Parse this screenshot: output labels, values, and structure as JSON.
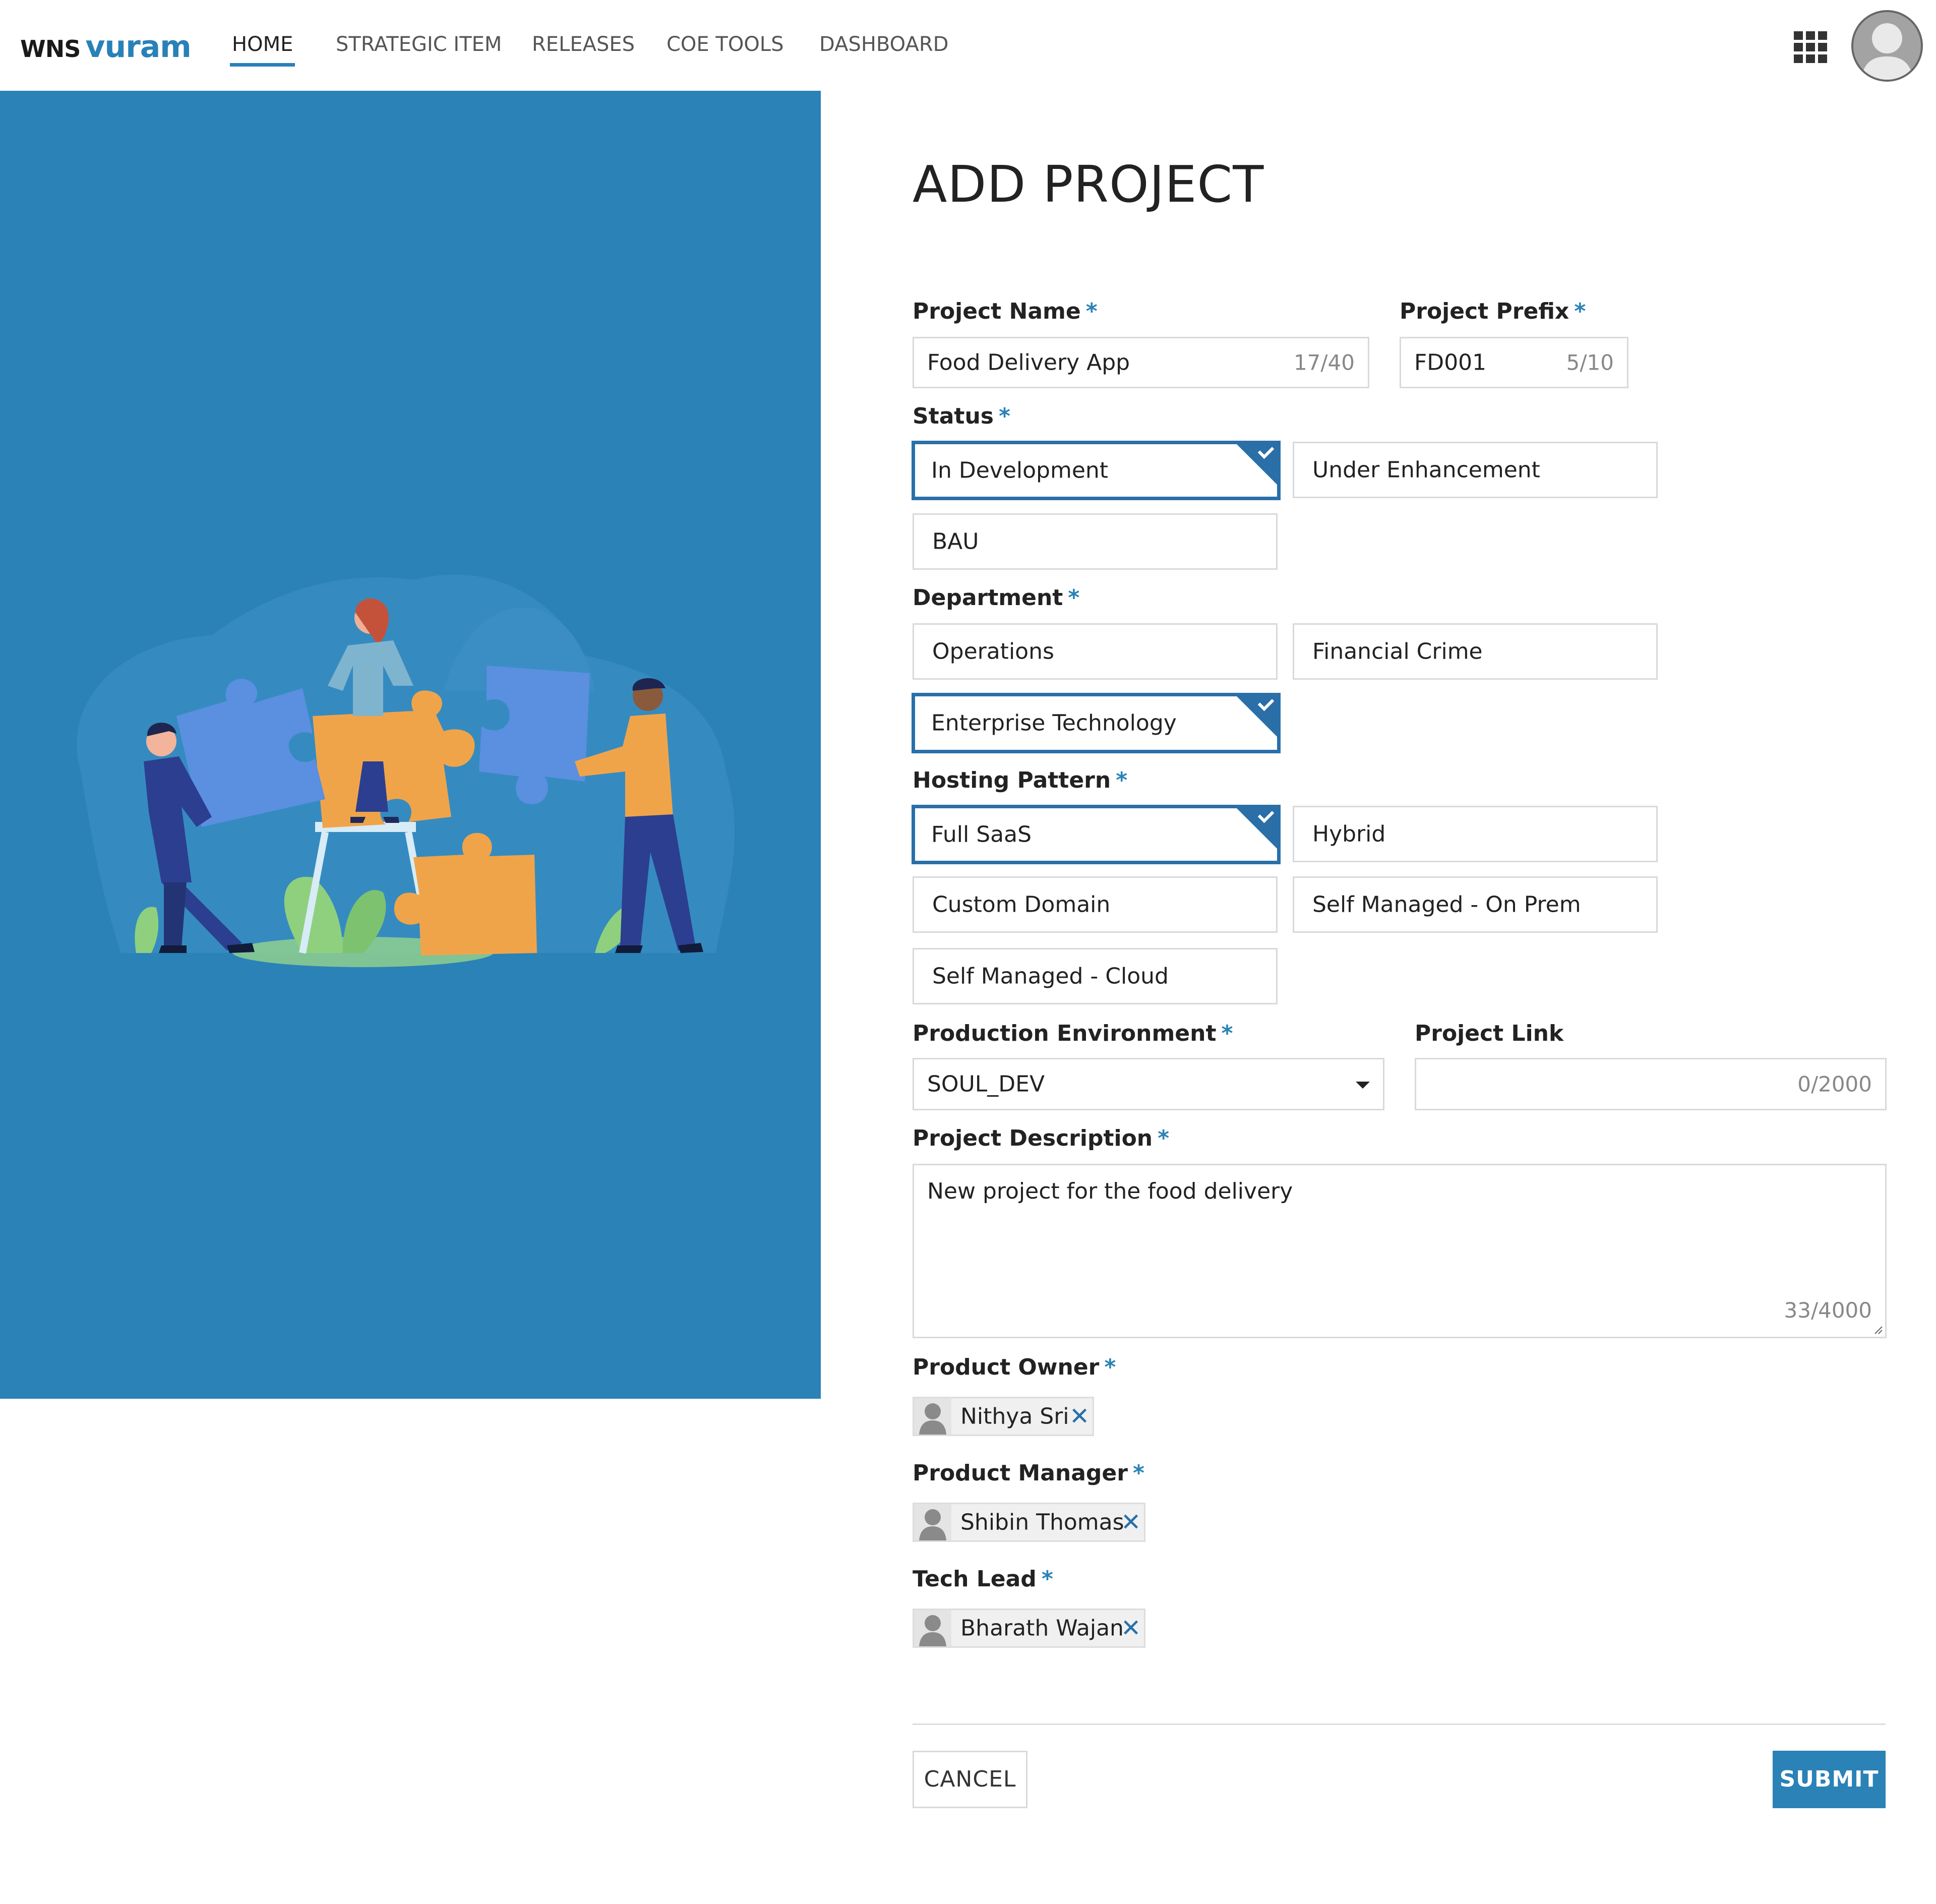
{
  "nav": {
    "logo_wns": "WNS",
    "logo_vuram": "vuram",
    "tabs": [
      "HOME",
      "STRATEGIC ITEM",
      "RELEASES",
      "COE TOOLS",
      "DASHBOARD"
    ],
    "active_tab": "HOME",
    "apps_icon": "apps-grid-icon",
    "avatar_icon": "user-avatar-icon"
  },
  "colors": {
    "accent": "#2a82b6",
    "banner": "#2a82b6",
    "selected_border": "#2a6fa8"
  },
  "form": {
    "title": "ADD PROJECT",
    "required_mark": "*",
    "project_name": {
      "label": "Project Name",
      "value": "Food Delivery App",
      "count": "17/40"
    },
    "project_prefix": {
      "label": "Project Prefix",
      "value": "FD001",
      "count": "5/10"
    },
    "status": {
      "label": "Status",
      "options": [
        "In Development",
        "Under Enhancement",
        "BAU"
      ],
      "selected": "In Development"
    },
    "department": {
      "label": "Department",
      "options": [
        "Operations",
        "Financial Crime",
        "Enterprise Technology"
      ],
      "selected": "Enterprise Technology"
    },
    "hosting_pattern": {
      "label": "Hosting Pattern",
      "options": [
        "Full SaaS",
        "Hybrid",
        "Custom Domain",
        "Self Managed - On Prem",
        "Self Managed - Cloud"
      ],
      "selected": "Full SaaS"
    },
    "production_environment": {
      "label": "Production Environment",
      "value": "SOUL_DEV"
    },
    "project_link": {
      "label": "Project Link",
      "value": "",
      "count": "0/2000"
    },
    "project_description": {
      "label": "Project Description",
      "value": "New project for the food delivery",
      "count": "33/4000"
    },
    "product_owner": {
      "label": "Product Owner",
      "person": "Nithya Sri"
    },
    "product_manager": {
      "label": "Product Manager",
      "person": "Shibin Thomas"
    },
    "tech_lead": {
      "label": "Tech Lead",
      "person": "Bharath Wajan"
    },
    "remove_symbol": "✕",
    "cancel_label": "CANCEL",
    "submit_label": "SUBMIT"
  }
}
